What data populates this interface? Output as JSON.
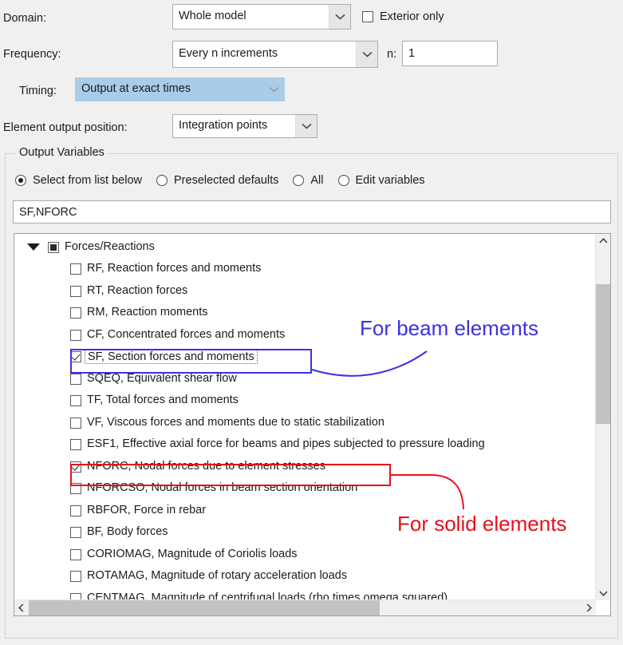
{
  "form": {
    "domain_label": "Domain:",
    "domain_value": "Whole model",
    "exterior_only_label": "Exterior only",
    "exterior_only_checked": false,
    "frequency_label": "Frequency:",
    "frequency_value": "Every n increments",
    "n_label": "n:",
    "n_value": "1",
    "timing_label": "Timing:",
    "timing_value": "Output at exact times",
    "element_output_position_label": "Element output position:",
    "element_output_position_value": "Integration points"
  },
  "group": {
    "legend": "Output Variables",
    "radios": [
      {
        "label": "Select from list below",
        "selected": true
      },
      {
        "label": "Preselected defaults",
        "selected": false
      },
      {
        "label": "All",
        "selected": false
      },
      {
        "label": "Edit variables",
        "selected": false
      }
    ],
    "selected_variables": "SF,NFORC"
  },
  "tree": {
    "root": {
      "label": "Forces/Reactions",
      "state": "partial",
      "expanded": true
    },
    "items": [
      {
        "label": "RF, Reaction forces and moments",
        "checked": false
      },
      {
        "label": "RT, Reaction forces",
        "checked": false
      },
      {
        "label": "RM, Reaction moments",
        "checked": false
      },
      {
        "label": "CF, Concentrated forces and moments",
        "checked": false
      },
      {
        "label": "SF, Section forces and moments",
        "checked": true,
        "focused": true
      },
      {
        "label": "SQEQ, Equivalent shear flow",
        "checked": false
      },
      {
        "label": "TF, Total forces and moments",
        "checked": false
      },
      {
        "label": "VF, Viscous forces and moments due to static stabilization",
        "checked": false
      },
      {
        "label": "ESF1, Effective axial force for beams and pipes subjected to pressure loading",
        "checked": false
      },
      {
        "label": "NFORC, Nodal forces due to element stresses",
        "checked": true
      },
      {
        "label": "NFORCSO, Nodal forces in beam section orientation",
        "checked": false
      },
      {
        "label": "RBFOR, Force in rebar",
        "checked": false
      },
      {
        "label": "BF, Body forces",
        "checked": false
      },
      {
        "label": "CORIOMAG, Magnitude of Coriolis loads",
        "checked": false
      },
      {
        "label": "ROTAMAG, Magnitude of rotary acceleration loads",
        "checked": false
      },
      {
        "label": "CENTMAG, Magnitude of centrifugal loads (rho times omega squared)",
        "checked": false
      }
    ]
  },
  "annotations": [
    {
      "text": "For beam elements",
      "color": "#3b32e0"
    },
    {
      "text": "For solid elements",
      "color": "#e8101a"
    }
  ],
  "colors": {
    "beam_annotation": "#3b32e0",
    "solid_annotation": "#e8101a",
    "selection_highlight": "#a9cde9"
  }
}
